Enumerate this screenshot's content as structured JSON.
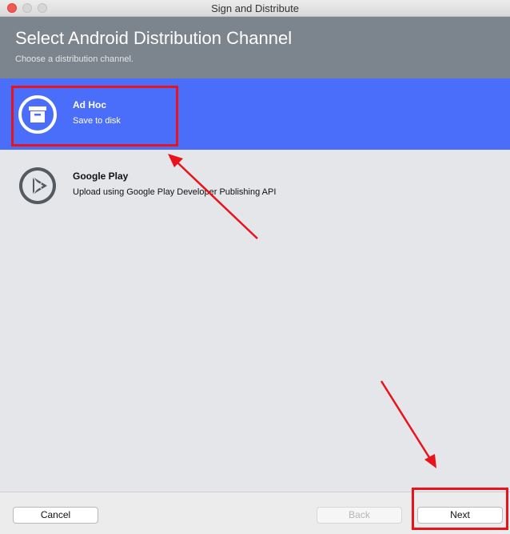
{
  "window": {
    "title": "Sign and Distribute"
  },
  "header": {
    "title": "Select Android Distribution Channel",
    "subtitle": "Choose a distribution channel."
  },
  "channels": [
    {
      "name": "Ad Hoc",
      "description": "Save to disk",
      "icon": "archive-box-icon",
      "selected": true
    },
    {
      "name": "Google Play",
      "description": "Upload using Google Play Developer Publishing API",
      "icon": "play-icon",
      "selected": false
    }
  ],
  "footer": {
    "cancel_label": "Cancel",
    "back_label": "Back",
    "next_label": "Next"
  },
  "colors": {
    "selection": "#4b6efa",
    "header_bg": "#7c858d",
    "annotation": "#e8131b"
  }
}
